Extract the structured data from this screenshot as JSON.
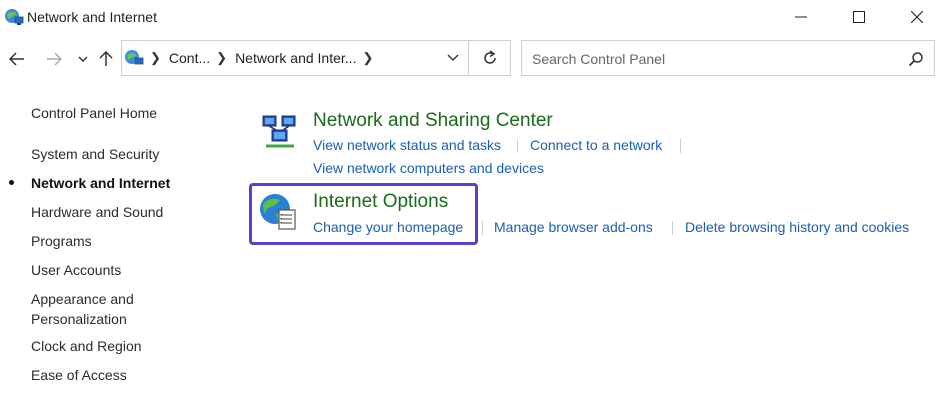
{
  "window": {
    "title": "Network and Internet",
    "minimize_icon": "minimize-icon",
    "maximize_icon": "maximize-icon",
    "close_icon": "close-icon"
  },
  "nav": {
    "breadcrumbs": [
      "Cont...",
      "Network and Inter..."
    ],
    "search_placeholder": "Search Control Panel"
  },
  "sidebar": {
    "items": [
      {
        "label": "Control Panel Home",
        "active": false
      },
      {
        "label": "System and Security",
        "active": false
      },
      {
        "label": "Network and Internet",
        "active": true
      },
      {
        "label": "Hardware and Sound",
        "active": false
      },
      {
        "label": "Programs",
        "active": false
      },
      {
        "label": "User Accounts",
        "active": false
      },
      {
        "label": "Appearance and Personalization",
        "active": false
      },
      {
        "label": "Clock and Region",
        "active": false
      },
      {
        "label": "Ease of Access",
        "active": false
      }
    ]
  },
  "sections": [
    {
      "title": "Network and Sharing Center",
      "icon": "network-sharing-icon",
      "links": [
        "View network status and tasks",
        "Connect to a network",
        "View network computers and devices"
      ]
    },
    {
      "title": "Internet Options",
      "icon": "internet-options-icon",
      "links": [
        "Change your homepage",
        "Manage browser add-ons",
        "Delete browsing history and cookies"
      ]
    }
  ],
  "colors": {
    "section_title": "#1a6b1a",
    "link": "#1a5fb4",
    "highlight": "#5b3fd1"
  }
}
